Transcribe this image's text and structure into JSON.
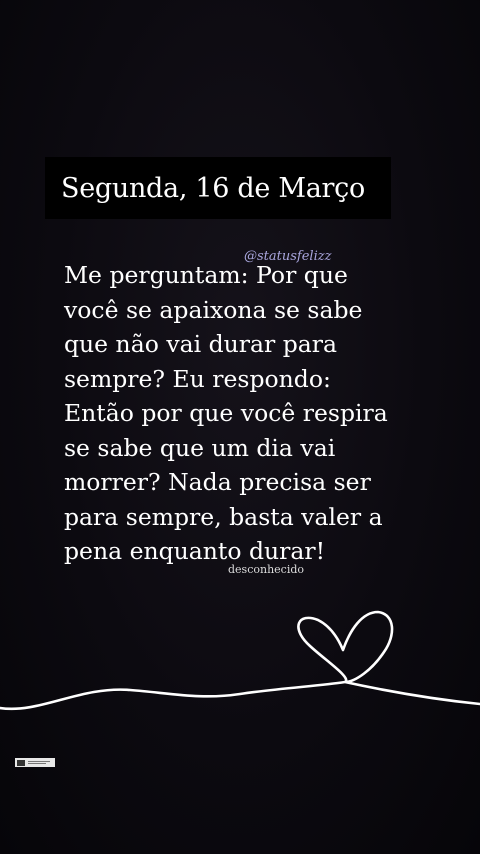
{
  "story": {
    "date": "Segunda, 16 de Março",
    "handle": "@statusfelizz",
    "quote_lines": [
      "Me perguntam: Por que",
      "você se apaixona se sabe",
      "que não vai durar para",
      "sempre?  Eu respondo:",
      "Então por que você respira",
      "se sabe que um dia vai",
      "morrer? Nada precisa ser",
      "para sempre, basta valer a",
      "pena enquanto durar!"
    ],
    "author": "desconhecido"
  },
  "colors": {
    "background": "#0c0a10",
    "banner": "#000000",
    "text": "#ffffff",
    "handle": "#a9a6dd"
  },
  "icons": {
    "heart_line": "heart-line-icon",
    "watermark": "watermark-icon"
  }
}
